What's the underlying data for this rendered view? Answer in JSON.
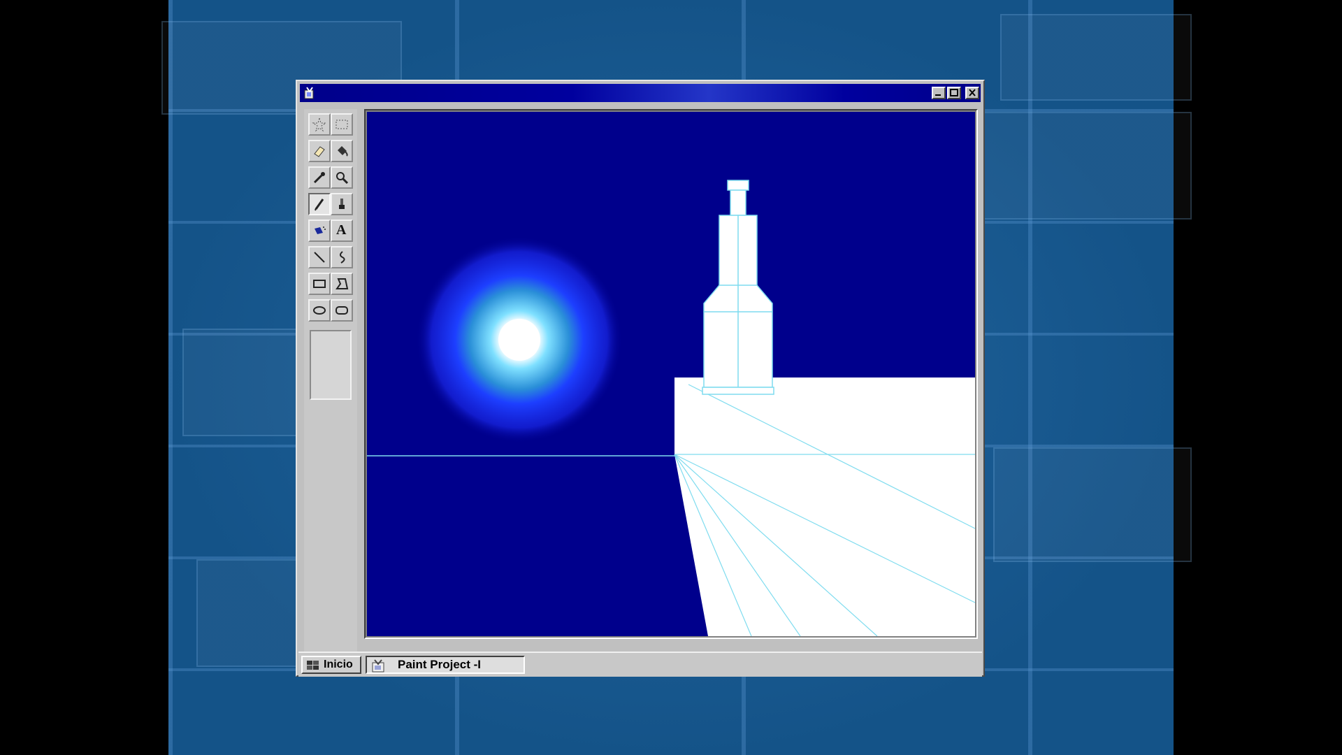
{
  "window": {
    "title": "",
    "controls": {
      "minimize_icon": "minimize-icon",
      "maximize_icon": "maximize-icon",
      "close_icon": "close-icon"
    }
  },
  "toolbox": {
    "tools": [
      {
        "name": "free-form-select",
        "icon": "star-select-icon"
      },
      {
        "name": "select",
        "icon": "rect-select-icon"
      },
      {
        "name": "eraser",
        "icon": "eraser-icon"
      },
      {
        "name": "fill",
        "icon": "fill-bucket-icon"
      },
      {
        "name": "pick-color",
        "icon": "eyedropper-icon"
      },
      {
        "name": "magnifier",
        "icon": "magnifier-icon"
      },
      {
        "name": "pencil",
        "icon": "pencil-icon",
        "active": true
      },
      {
        "name": "brush",
        "icon": "brush-icon"
      },
      {
        "name": "airbrush",
        "icon": "airbrush-icon"
      },
      {
        "name": "text",
        "icon": "text-icon",
        "glyph": "A"
      },
      {
        "name": "line",
        "icon": "line-icon"
      },
      {
        "name": "curve",
        "icon": "curve-icon"
      },
      {
        "name": "rectangle",
        "icon": "rectangle-icon"
      },
      {
        "name": "polygon",
        "icon": "polygon-icon"
      },
      {
        "name": "ellipse",
        "icon": "ellipse-icon"
      },
      {
        "name": "rounded-rectangle",
        "icon": "rounded-rectangle-icon"
      }
    ]
  },
  "canvas": {
    "background_color": "#00008c",
    "drawing_colors": {
      "glow": "#1a3cff",
      "star_core": "#ffffff",
      "line": "#7fdcef",
      "ground": "#ffffff"
    }
  },
  "taskbar": {
    "start_label": "Inicio",
    "task_label": "Paint Project -I"
  }
}
